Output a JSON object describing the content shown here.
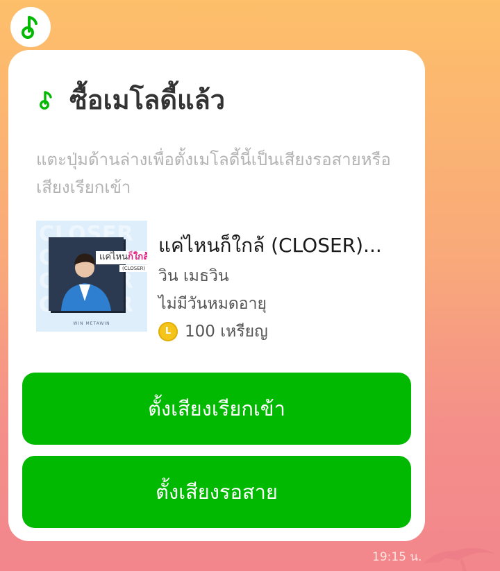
{
  "message": {
    "title": "ซื้อเมโลดี้แล้ว",
    "description": "แตะปุ่มด้านล่างเพื่อตั้งเมโลดี้นี้เป็นเสียงรอสายหรือเสียงเรียกเข้า",
    "timestamp": "19:15 น."
  },
  "song": {
    "title": "แค่ไหนก็ใกล้ (CLOSER)...",
    "artist": "วิน เมธวิน",
    "validity": "ไม่มีวันหมดอายุ",
    "price": "100 เหรียญ",
    "coin_letter": "L",
    "cover": {
      "title_plain": "แค่ไหน",
      "title_accent": "ก็ใกล้",
      "subtitle": "(CLOSER)",
      "artist_caption": "WIN METAWIN",
      "background_text": "CLOSER"
    }
  },
  "buttons": {
    "set_ringtone": "ตั้งเสียงเรียกเข้า",
    "set_ringback": "ตั้งเสียงรอสาย"
  },
  "icons": {
    "avatar": "music-note-icon",
    "title": "music-note-icon",
    "coin": "line-coin-icon"
  },
  "colors": {
    "accent_green": "#00b900",
    "coin_yellow": "#f4c518",
    "cover_pink": "#e0147a"
  }
}
